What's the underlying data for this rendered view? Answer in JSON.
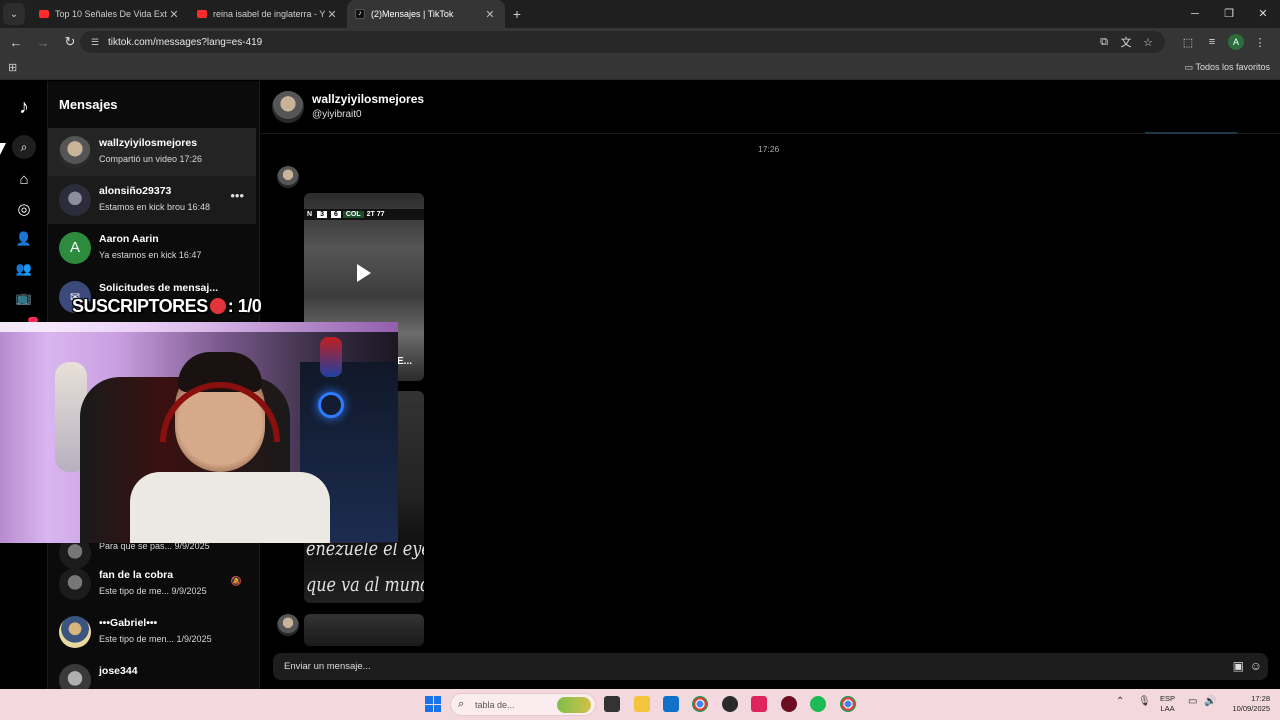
{
  "browser": {
    "tabs": [
      {
        "title": "Top 10 Señales De Vida Extrate",
        "icon": "youtube-icon"
      },
      {
        "title": "reina isabel de inglaterra - YouT",
        "icon": "youtube-icon"
      },
      {
        "title": "(2)Mensajes | TikTok",
        "icon": "tiktok-icon"
      }
    ],
    "url": "tiktok.com/messages?lang=es-419",
    "bookmarks_folder": "Todos los favoritos",
    "profile_initial": "A"
  },
  "tiktok": {
    "messages_title": "Mensajes",
    "conversations": [
      {
        "name": "wallzyiyilosmejores",
        "preview": "Compartió un video 17:26"
      },
      {
        "name": "alonsiño29373",
        "preview": "Estamos en kick brou 16:48"
      },
      {
        "name": "Aaron Aarin",
        "initial": "A",
        "preview": "Ya estamos en kick 16:47"
      },
      {
        "name": "Solicitudes de mensaj...",
        "preview": ""
      },
      {
        "name": "",
        "preview": "Para que se pas...  9/9/2025"
      },
      {
        "name": "fan de la cobra",
        "preview": "Este tipo de me...  9/9/2025"
      },
      {
        "name": "•••Gabriel•••",
        "preview": "Este tipo de men...  1/9/2025"
      },
      {
        "name": "jose344",
        "preview": ""
      }
    ],
    "chat": {
      "name": "wallzyiyilosmejores",
      "handle": "@yiyibrait0",
      "timestamp": "17:26",
      "video1": {
        "score_left": "3",
        "score_right": "6",
        "team": "COL",
        "period": "2T 77",
        "gol": "GOL",
        "caption": "E..."
      },
      "video2": {
        "overlay_line1": "enezuele el eyendo",
        "overlay_line2": "que va al mundial"
      },
      "composer_placeholder": "Enviar un mensaje..."
    }
  },
  "stream_overlay": {
    "subscribers_label": "SUSCRIPTORES",
    "subscribers_value": ": 1/0"
  },
  "taskbar": {
    "search_text": "tabla de...",
    "lang_line1": "ESP",
    "lang_line2": "LAA",
    "time": "17:28",
    "date": "10/09/2025"
  }
}
